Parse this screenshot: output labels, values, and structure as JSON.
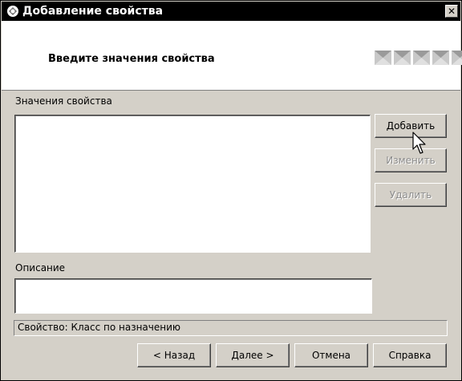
{
  "window": {
    "title": "Добавление свойства",
    "close_symbol": "✕"
  },
  "header": {
    "title": "Введите значения свойства",
    "steps_icon": "wizard-step-icon"
  },
  "values": {
    "label": "Значения свойства",
    "items": []
  },
  "buttons": {
    "add": "Добавить",
    "edit": "Изменить",
    "delete": "Удалить"
  },
  "description": {
    "label": "Описание",
    "value": ""
  },
  "status": {
    "text": "Свойство: Класс по назначению"
  },
  "footer": {
    "back": "< Назад",
    "next": "Далее >",
    "cancel": "Отмена",
    "help": "Справка"
  },
  "colors": {
    "dialog_bg": "#d4d0c8",
    "titlebar_bg": "#000000",
    "disabled_text": "#8c8c8c"
  }
}
